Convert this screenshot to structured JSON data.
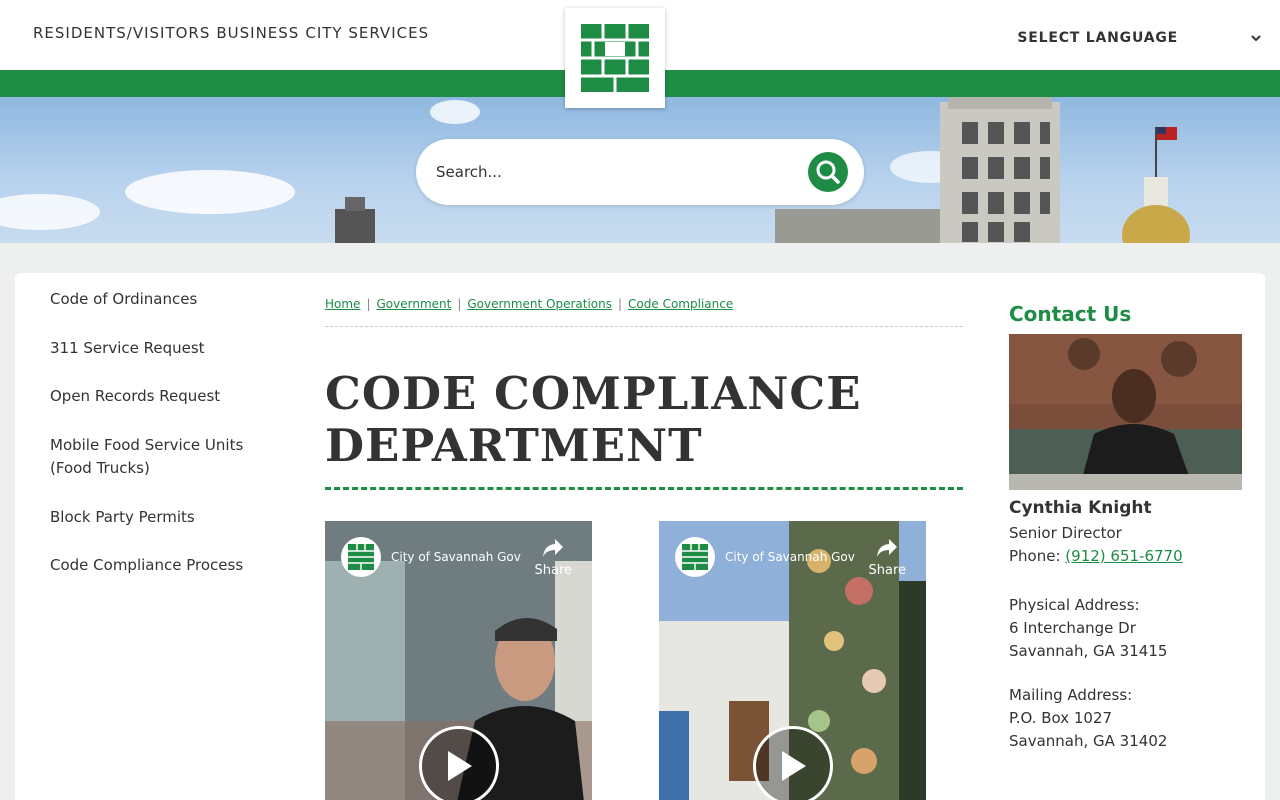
{
  "topnav": {
    "items": [
      "RESIDENTS/VISITORS",
      "BUSINESS",
      "CITY SERVICES"
    ]
  },
  "language": {
    "label": "SELECT LANGUAGE"
  },
  "search": {
    "placeholder": "Search..."
  },
  "sidenav": {
    "items": [
      "Code of Ordinances",
      "311 Service Request",
      "Open Records Request",
      "Mobile Food Service Units (Food Trucks)",
      "Block Party Permits",
      "Code Compliance Process"
    ]
  },
  "breadcrumb": [
    "Home",
    "Government",
    "Government Operations",
    "Code Compliance"
  ],
  "page": {
    "title": "CODE COMPLIANCE DEPARTMENT"
  },
  "videos": [
    {
      "channel": "City of Savannah Gov",
      "share": "Share"
    },
    {
      "channel": "City of Savannah Gov",
      "share": "Share"
    }
  ],
  "contact": {
    "heading": "Contact Us",
    "name": "Cynthia Knight",
    "role": "Senior Director",
    "phone_label": "Phone: ",
    "phone": "(912) 651-6770",
    "physical_label": "Physical Address:",
    "physical_line1": "6 Interchange Dr",
    "physical_line2": "Savannah, GA 31415",
    "mailing_label": "Mailing Address:",
    "mailing_line1": "P.O. Box 1027",
    "mailing_line2": "Savannah, GA 31402"
  },
  "colors": {
    "brand_green": "#1e8c45"
  }
}
